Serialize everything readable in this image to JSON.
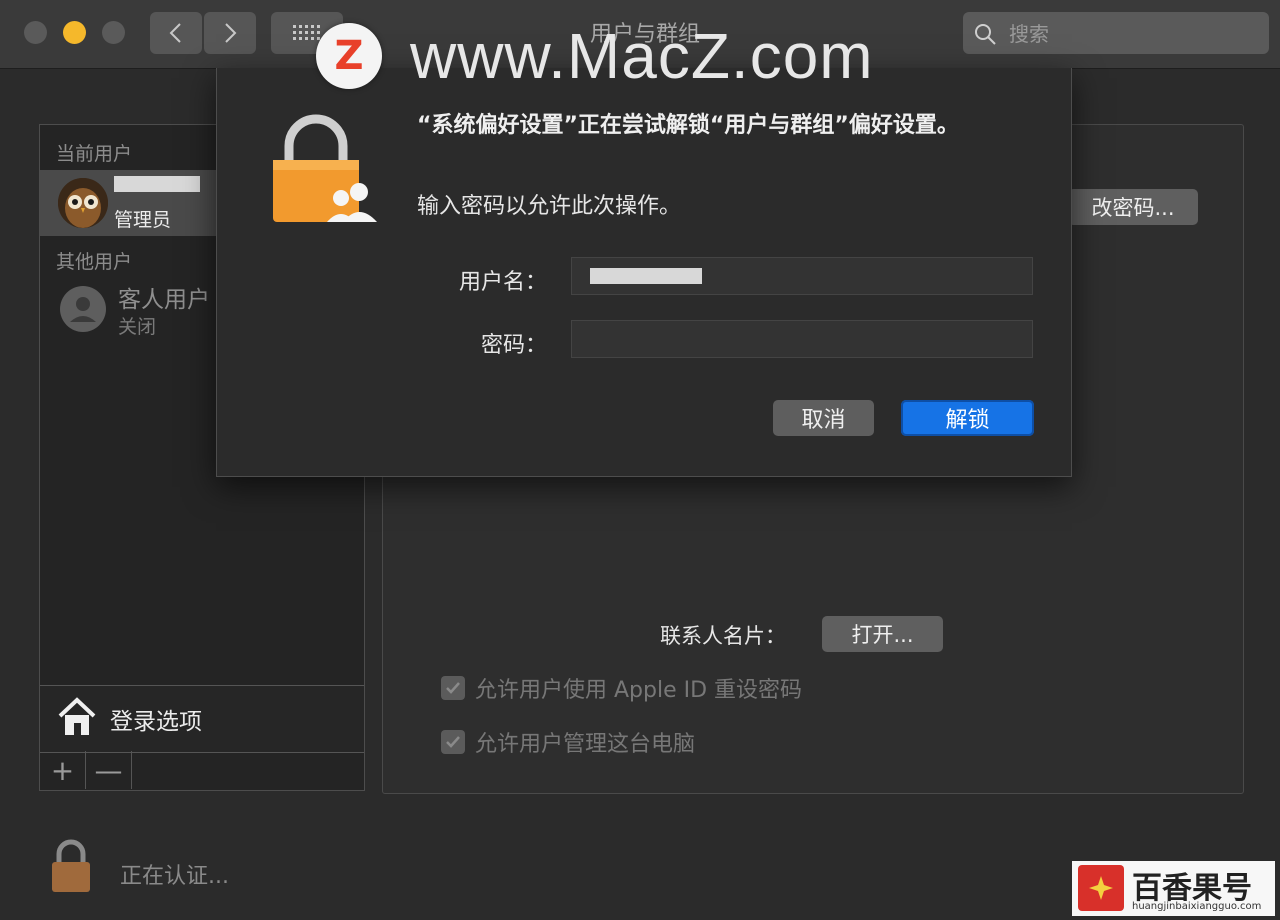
{
  "window": {
    "title": "用户与群组"
  },
  "search": {
    "placeholder": "搜索"
  },
  "watermark": {
    "logo_letter": "Z",
    "text": "www.MacZ.com"
  },
  "sidebar": {
    "current_users_label": "当前用户",
    "current_user": {
      "role": "管理员"
    },
    "other_users_label": "其他用户",
    "guest": {
      "name": "客人用户",
      "status": "关闭"
    },
    "login_options_label": "登录选项",
    "add_symbol": "+",
    "remove_symbol": "—"
  },
  "panel": {
    "change_password_label": "改密码...",
    "contact_card_label": "联系人名片：",
    "open_button_label": "打开...",
    "checkboxes": [
      {
        "label": "允许用户使用 Apple ID 重设密码",
        "checked": true
      },
      {
        "label": "允许用户管理这台电脑",
        "checked": true
      }
    ]
  },
  "footer": {
    "auth_status": "正在认证..."
  },
  "dialog": {
    "message": "“系统偏好设置”正在尝试解锁“用户与群组”偏好设置。",
    "instruction": "输入密码以允许此次操作。",
    "username_label": "用户名：",
    "password_label": "密码：",
    "password_value": "",
    "cancel_label": "取消",
    "unlock_label": "解锁"
  },
  "brand": {
    "name": "百香果号",
    "url": "huangjinbaixiangguo.com"
  },
  "colors": {
    "accent": "#1673e6",
    "background": "#2b2b2b",
    "watermark_red": "#e8402a",
    "minimize": "#f5b82b"
  }
}
